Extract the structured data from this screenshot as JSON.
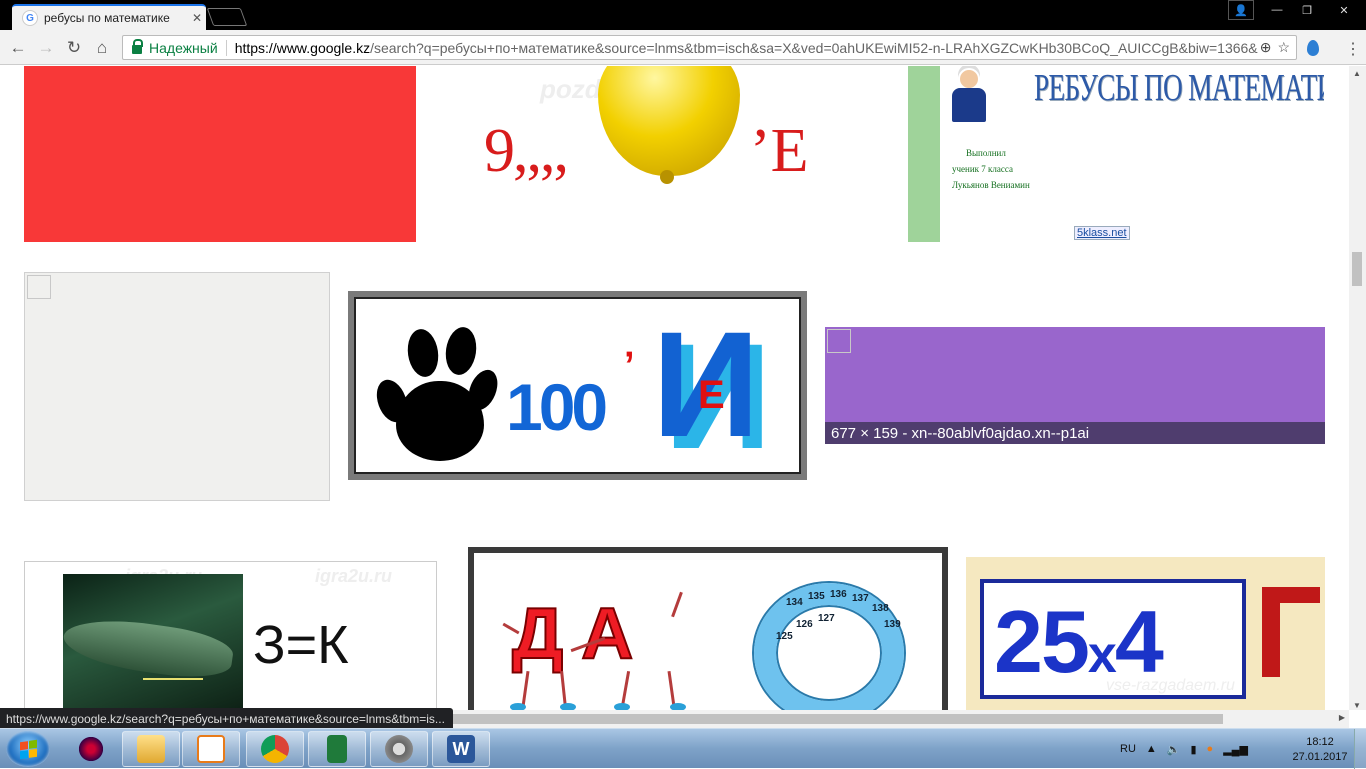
{
  "browser": {
    "tab_title": "ребусы по математике",
    "tab_close": "✕",
    "secure_label": "Надежный",
    "url_scheme_host": "https://www.google.kz",
    "url_rest": "/search?q=ребусы+по+математике&source=lnms&tbm=isch&sa=X&ved=0ahUKEwiMI52-n-LRAhXGZCwKHb30BCoQ_AUICCgB&biw=1366&",
    "status_url": "https://www.google.kz/search?q=ребусы+по+математике&source=lnms&tbm=is..."
  },
  "images": {
    "lemon_left": "9,,,,",
    "lemon_right": "’Е",
    "lemon_watermark": "pozdravok.ru",
    "slide_title": "РЕБУСЫ ПО МАТЕМАТИКЕ",
    "slide_line1": "Выполнил",
    "slide_line2": "ученик 7 класса",
    "slide_line3": "Лукьянов Вениамин",
    "slide_badge": "5klass.net",
    "paw_number": "100",
    "paw_comma": "’",
    "paw_big_letter": "И",
    "paw_small_letter": "Е",
    "purple_caption": "677 × 159 - xn--80ablvf0ajdao.xn--p1ai",
    "shark_eq": "З=К",
    "shark_watermark": "igra2u.ru",
    "da_letters": "ДА",
    "num_25": "25",
    "num_x": "x",
    "num_4": "4",
    "vse_watermark": "vse-razgadaem.ru",
    "tape_numbers": [
      "134",
      "135",
      "136",
      "137",
      "138",
      "139",
      "125",
      "126",
      "127"
    ]
  },
  "taskbar": {
    "lang": "RU",
    "time": "18:12",
    "date": "27.01.2017"
  }
}
